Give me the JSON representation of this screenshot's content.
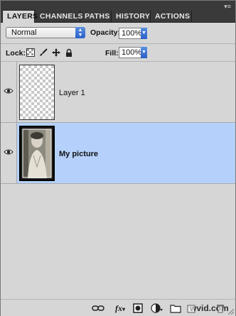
{
  "tabs": [
    {
      "label": "LAYERS",
      "active": true
    },
    {
      "label": "CHANNELS",
      "active": false
    },
    {
      "label": "PATHS",
      "active": false
    },
    {
      "label": "HISTORY",
      "active": false
    },
    {
      "label": "ACTIONS",
      "active": false
    }
  ],
  "blend_mode": {
    "value": "Normal"
  },
  "opacity": {
    "label": "Opacity:",
    "value": "100%"
  },
  "lock": {
    "label": "Lock:",
    "icons": [
      "lock-transparent-pixels-icon",
      "lock-image-pixels-icon",
      "lock-position-icon",
      "lock-all-icon"
    ]
  },
  "fill": {
    "label": "Fill:",
    "value": "100%"
  },
  "layers": [
    {
      "name": "Layer 1",
      "visible": true,
      "selected": false,
      "thumbnail": "transparent"
    },
    {
      "name": "My picture",
      "visible": true,
      "selected": true,
      "thumbnail": "photo"
    }
  ],
  "bottom_toolbar": {
    "icons": [
      "link-layers-icon",
      "layer-style-fx-icon",
      "layer-mask-icon",
      "adjustment-layer-icon",
      "new-group-icon",
      "new-layer-icon",
      "delete-layer-icon"
    ],
    "fx_label": "fx",
    "watermark": "wvid.com"
  },
  "colors": {
    "selection": "#b5d1fb",
    "tabbar": "#3a3a3a",
    "accent": "#2a60c8"
  }
}
